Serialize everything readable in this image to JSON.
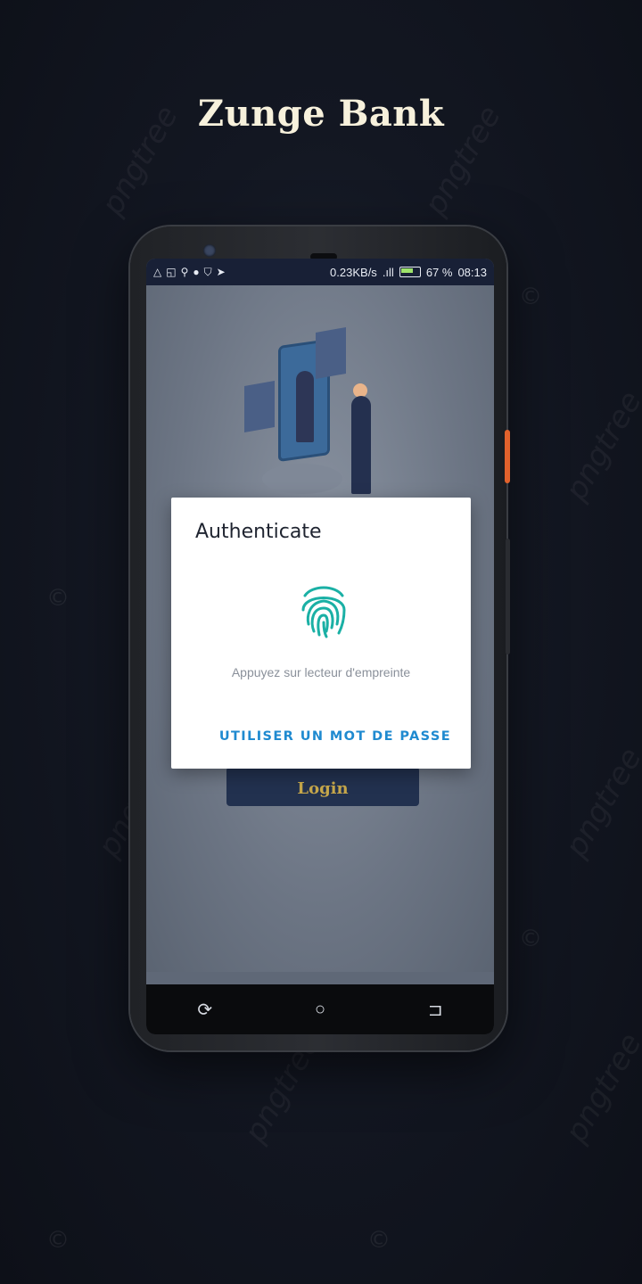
{
  "app": {
    "brand_title": "Zunge Bank"
  },
  "watermark": {
    "text": "pngtree",
    "copyright": "©"
  },
  "status_bar": {
    "left_icons": [
      "warning-icon",
      "screencast-icon",
      "usb-icon",
      "circle-icon",
      "shield-icon",
      "telegram-icon"
    ],
    "speed": "0.23KB/s",
    "battery_percent": "67 %",
    "time": "08:13"
  },
  "login": {
    "button_label": "Login"
  },
  "dialog": {
    "title": "Authenticate",
    "message": "Appuyez sur lecteur d'empreinte",
    "action_label": "UTILISER UN MOT DE PASSE"
  },
  "navbar": {
    "items": [
      "recent-apps",
      "home",
      "back"
    ]
  },
  "colors": {
    "accent": "#1f8ad0",
    "fingerprint": "#1ab0a5",
    "statusbar": "#182036",
    "login_btn": "#22314f",
    "login_text": "#c7a84b"
  }
}
